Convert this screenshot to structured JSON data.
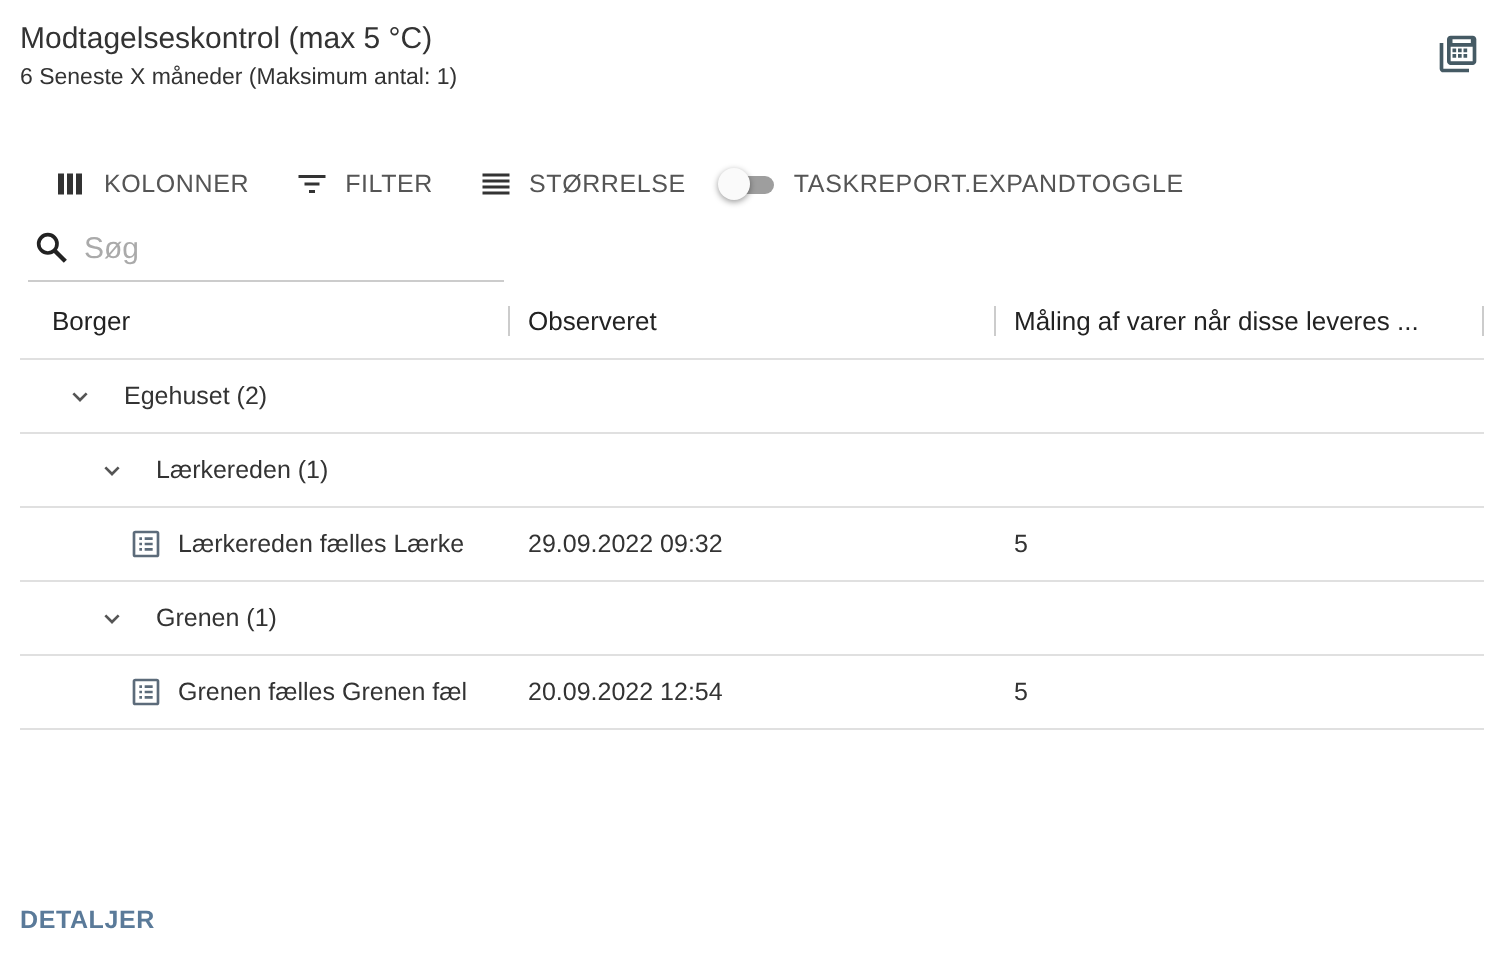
{
  "title": "Modtagelseskontrol (max 5 °C)",
  "subtitle": "6 Seneste X måneder (Maksimum antal: 1)",
  "toolbar": [
    {
      "kind": "button",
      "label": "KOLONNER"
    },
    {
      "kind": "button",
      "label": "FILTER"
    },
    {
      "kind": "button",
      "label": "STØRRELSE"
    },
    {
      "kind": "toggle",
      "label": "TASKREPORT.EXPANDTOGGLE",
      "on": false
    }
  ],
  "search": {
    "placeholder": "Søg"
  },
  "table": {
    "columns": [
      "Borger",
      "Observeret",
      "Måling af varer når disse leveres ..."
    ],
    "rows": [
      {
        "kind": "group",
        "label": "Egehuset (2)",
        "expanded": true,
        "children": [
          {
            "kind": "group",
            "label": "Lærkereden (1)",
            "expanded": true,
            "children": [
              {
                "kind": "record",
                "cells": [
                  "Lærkereden fælles Lærke",
                  "29.09.2022 09:32",
                  "5"
                ]
              }
            ]
          },
          {
            "kind": "group",
            "label": "Grenen (1)",
            "expanded": true,
            "children": [
              {
                "kind": "record",
                "cells": [
                  "Grenen fælles Grenen fæl",
                  "20.09.2022 12:54",
                  "5"
                ]
              }
            ]
          }
        ]
      }
    ]
  },
  "footer_link": "DETALJER"
}
